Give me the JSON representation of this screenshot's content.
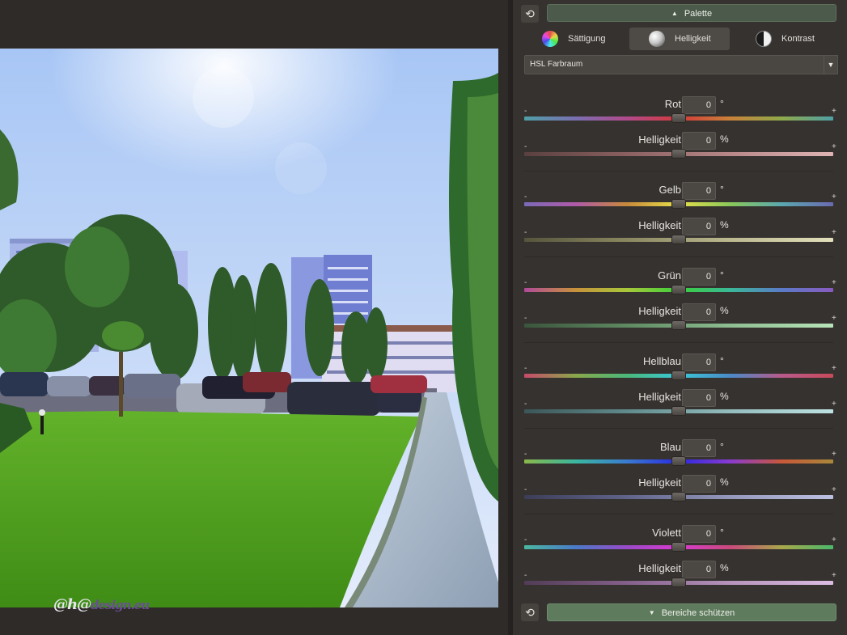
{
  "photo": {
    "watermark_prefix": "@h@",
    "watermark_domain": "design.eu"
  },
  "panel": {
    "palette_label": "Palette",
    "protect_label": "Bereiche schützen",
    "reset_icon": "reset-arrows-icon",
    "tabs": [
      {
        "label": "Sättigung",
        "icon": "color-wheel-icon",
        "active": false
      },
      {
        "label": "Helligkeit",
        "icon": "brightness-sphere-icon",
        "active": true
      },
      {
        "label": "Kontrast",
        "icon": "contrast-icon",
        "active": false
      }
    ],
    "colorspace": {
      "value": "HSL Farbraum",
      "arrow": "▼"
    },
    "minus_symbol": "-",
    "plus_symbol": "+",
    "sliders": [
      {
        "group": "rot",
        "label": "Rot",
        "value": "0",
        "unit": "°",
        "kind": "hue",
        "position": 0.5
      },
      {
        "group": "rot",
        "label": "Helligkeit",
        "value": "0",
        "unit": "%",
        "kind": "lum",
        "position": 0.5
      },
      {
        "group": "gelb",
        "label": "Gelb",
        "value": "0",
        "unit": "°",
        "kind": "hue",
        "position": 0.5
      },
      {
        "group": "gelb",
        "label": "Helligkeit",
        "value": "0",
        "unit": "%",
        "kind": "lum",
        "position": 0.5
      },
      {
        "group": "gruen",
        "label": "Grün",
        "value": "0",
        "unit": "°",
        "kind": "hue",
        "position": 0.5
      },
      {
        "group": "gruen",
        "label": "Helligkeit",
        "value": "0",
        "unit": "%",
        "kind": "lum",
        "position": 0.5
      },
      {
        "group": "hellblau",
        "label": "Hellblau",
        "value": "0",
        "unit": "°",
        "kind": "hue",
        "position": 0.5
      },
      {
        "group": "hellblau",
        "label": "Helligkeit",
        "value": "0",
        "unit": "%",
        "kind": "lum",
        "position": 0.5
      },
      {
        "group": "blau",
        "label": "Blau",
        "value": "0",
        "unit": "°",
        "kind": "hue",
        "position": 0.5
      },
      {
        "group": "blau",
        "label": "Helligkeit",
        "value": "0",
        "unit": "%",
        "kind": "lum",
        "position": 0.5
      },
      {
        "group": "violett",
        "label": "Violett",
        "value": "0",
        "unit": "°",
        "kind": "hue",
        "position": 0.5
      },
      {
        "group": "violett",
        "label": "Helligkeit",
        "value": "0",
        "unit": "%",
        "kind": "lum",
        "position": 0.5
      }
    ],
    "track_colors": {
      "rot_hue": [
        "#4fa0a6",
        "#7a6fb2",
        "#b24a8c",
        "#d43a3a",
        "#c9823a",
        "#8faa4a",
        "#4fa0a6"
      ],
      "rot_lum": [
        "#5a4040",
        "#8a6060",
        "#b88888",
        "#e0b4b4"
      ],
      "gelb_hue": [
        "#7a6ab8",
        "#b05aa8",
        "#c88a3a",
        "#e6e04a",
        "#8ac85a",
        "#5aa8b0",
        "#6a6ab0"
      ],
      "gelb_lum": [
        "#56543c",
        "#8a8760",
        "#bcb890",
        "#e2e0bc"
      ],
      "gruen_hue": [
        "#b04a98",
        "#c8923a",
        "#a8c83a",
        "#3ad03a",
        "#3ab898",
        "#5a7ac8",
        "#8a5ac0"
      ],
      "gruen_lum": [
        "#3a553c",
        "#5f8a62",
        "#8fbe92",
        "#b8e4ba"
      ],
      "hellblau_hue": [
        "#c84a6a",
        "#8aa84a",
        "#4ab87a",
        "#3ac8d8",
        "#4a8ac8",
        "#b85a8a",
        "#c84a5a"
      ],
      "hellblau_lum": [
        "#3c5658",
        "#608a8c",
        "#94bcbe",
        "#bee2e2"
      ],
      "blau_hue": [
        "#8ab84a",
        "#3ab8a0",
        "#3a7ad0",
        "#2a2ae0",
        "#8a3ad0",
        "#c8583a",
        "#a8883a"
      ],
      "blau_lum": [
        "#3c3e58",
        "#60638a",
        "#9498bc",
        "#bcc0e2"
      ],
      "violett_hue": [
        "#4ab8a0",
        "#4a7ac8",
        "#9a4ac8",
        "#d83ad0",
        "#c84a7a",
        "#a8a84a",
        "#4ab86a"
      ],
      "violett_lum": [
        "#523c56",
        "#84608a",
        "#b694bc",
        "#dcbce2"
      ]
    }
  }
}
